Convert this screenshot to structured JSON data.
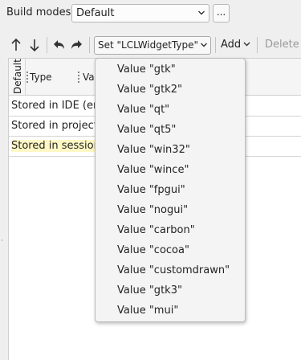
{
  "build_modes": {
    "label": "Build modes",
    "selected": "Default",
    "more_label": "..."
  },
  "toolbar": {
    "set_label": "Set \"LCLWidgetType\"",
    "add_label": "Add",
    "delete_label": "Delete",
    "icons": [
      "arrow-up-icon",
      "arrow-down-icon",
      "undo-icon",
      "redo-icon"
    ]
  },
  "grid": {
    "headers": {
      "default": "Default",
      "type": "Type",
      "value": "Va"
    },
    "rows": [
      {
        "label": "Stored in IDE (env"
      },
      {
        "label": "Stored in project ("
      },
      {
        "label": "Stored in session"
      }
    ]
  },
  "menu": {
    "items": [
      "Value \"gtk\"",
      "Value \"gtk2\"",
      "Value \"qt\"",
      "Value \"qt5\"",
      "Value \"win32\"",
      "Value \"wince\"",
      "Value \"fpgui\"",
      "Value \"nogui\"",
      "Value \"carbon\"",
      "Value \"cocoa\"",
      "Value \"customdrawn\"",
      "Value \"gtk3\"",
      "Value \"mui\""
    ]
  }
}
